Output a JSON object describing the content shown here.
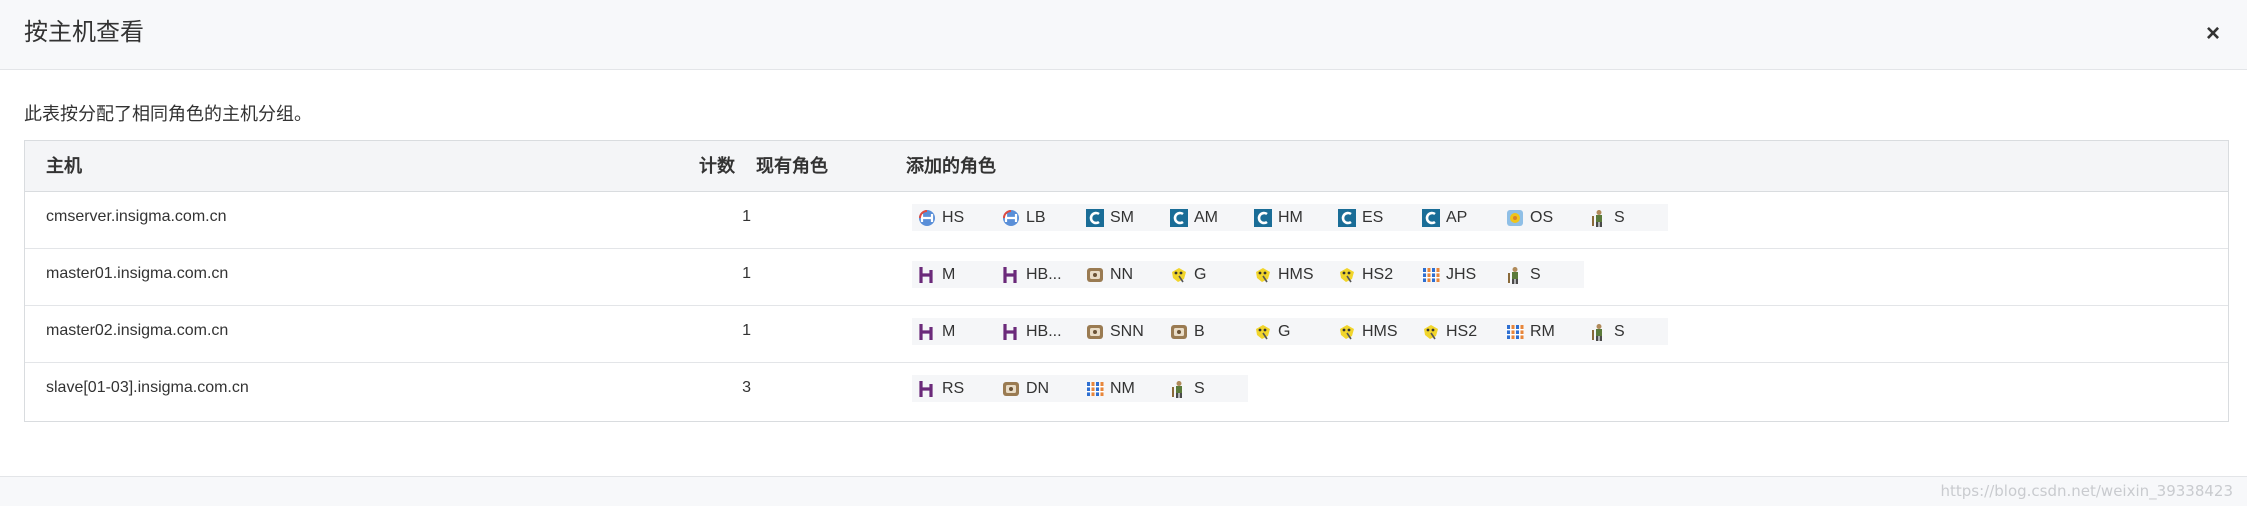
{
  "dialog": {
    "title": "按主机查看",
    "close_label": "×"
  },
  "description": "此表按分配了相同角色的主机分组。",
  "table": {
    "headers": {
      "host": "主机",
      "count": "计数",
      "existing": "现有角色",
      "added": "添加的角色"
    },
    "rows": [
      {
        "host": "cmserver.insigma.com.cn",
        "count": "1",
        "roles": [
          {
            "icon": "hive-server-icon",
            "label": "HS"
          },
          {
            "icon": "hive-server-icon",
            "label": "LB"
          },
          {
            "icon": "cloudera-icon",
            "label": "SM"
          },
          {
            "icon": "cloudera-icon",
            "label": "AM"
          },
          {
            "icon": "cloudera-icon",
            "label": "HM"
          },
          {
            "icon": "cloudera-icon",
            "label": "ES"
          },
          {
            "icon": "cloudera-icon",
            "label": "AP"
          },
          {
            "icon": "oozie-icon",
            "label": "OS"
          },
          {
            "icon": "zookeeper-icon",
            "label": "S"
          }
        ]
      },
      {
        "host": "master01.insigma.com.cn",
        "count": "1",
        "roles": [
          {
            "icon": "hbase-icon",
            "label": "M"
          },
          {
            "icon": "hbase-icon",
            "label": "HB..."
          },
          {
            "icon": "hdfs-icon",
            "label": "NN"
          },
          {
            "icon": "hive-icon",
            "label": "G"
          },
          {
            "icon": "hive-icon",
            "label": "HMS"
          },
          {
            "icon": "hive-icon",
            "label": "HS2"
          },
          {
            "icon": "yarn-icon",
            "label": "JHS"
          },
          {
            "icon": "zookeeper-icon",
            "label": "S"
          }
        ]
      },
      {
        "host": "master02.insigma.com.cn",
        "count": "1",
        "roles": [
          {
            "icon": "hbase-icon",
            "label": "M"
          },
          {
            "icon": "hbase-icon",
            "label": "HB..."
          },
          {
            "icon": "hdfs-icon",
            "label": "SNN"
          },
          {
            "icon": "hdfs-icon",
            "label": "B"
          },
          {
            "icon": "hive-icon",
            "label": "G"
          },
          {
            "icon": "hive-icon",
            "label": "HMS"
          },
          {
            "icon": "hive-icon",
            "label": "HS2"
          },
          {
            "icon": "yarn-icon",
            "label": "RM"
          },
          {
            "icon": "zookeeper-icon",
            "label": "S"
          }
        ]
      },
      {
        "host": "slave[01-03].insigma.com.cn",
        "count": "3",
        "roles": [
          {
            "icon": "hbase-icon",
            "label": "RS"
          },
          {
            "icon": "hdfs-icon",
            "label": "DN"
          },
          {
            "icon": "yarn-icon",
            "label": "NM"
          },
          {
            "icon": "zookeeper-icon",
            "label": "S"
          }
        ]
      }
    ]
  },
  "watermark": "https://blog.csdn.net/weixin_39338423"
}
